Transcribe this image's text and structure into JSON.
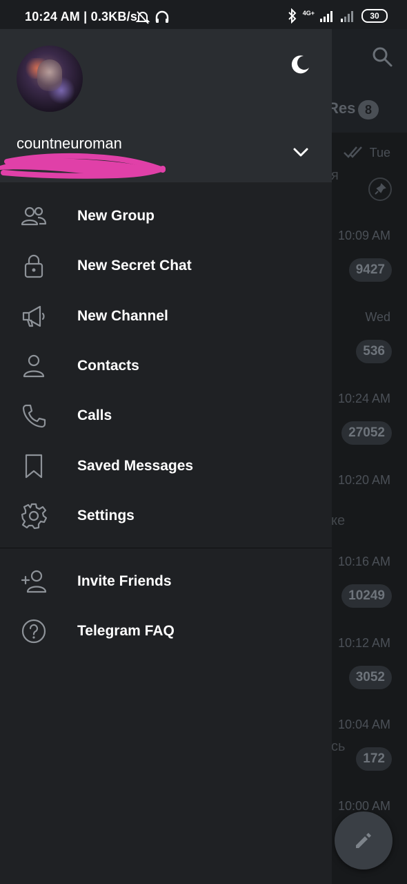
{
  "statusbar": {
    "time": "10:24 AM",
    "speed": "| 0.3KB/s",
    "network": "4G+",
    "battery": "30"
  },
  "background": {
    "tab_label": "Res",
    "tab_count": "8",
    "rows": [
      {
        "time": "Tue",
        "snippet": "я",
        "count": ""
      },
      {
        "time": "10:09 AM",
        "snippet": "",
        "count": "9427"
      },
      {
        "time": "Wed",
        "snippet": "",
        "count": "536"
      },
      {
        "time": "10:24 AM",
        "snippet": "",
        "count": "27052"
      },
      {
        "time": "10:20 AM",
        "snippet": "ке",
        "count": ""
      },
      {
        "time": "10:16 AM",
        "snippet": "",
        "count": "10249"
      },
      {
        "time": "10:12 AM",
        "snippet": "",
        "count": "3052"
      },
      {
        "time": "10:04 AM",
        "snippet": "сь",
        "count": "172"
      },
      {
        "time": "10:00 AM",
        "snippet": "",
        "count": ""
      }
    ]
  },
  "drawer": {
    "username": "countneuroman",
    "menu": [
      {
        "label": "New Group",
        "icon": "group-icon"
      },
      {
        "label": "New Secret Chat",
        "icon": "lock-icon"
      },
      {
        "label": "New Channel",
        "icon": "megaphone-icon"
      },
      {
        "label": "Contacts",
        "icon": "person-icon"
      },
      {
        "label": "Calls",
        "icon": "phone-icon"
      },
      {
        "label": "Saved Messages",
        "icon": "bookmark-icon"
      },
      {
        "label": "Settings",
        "icon": "gear-icon"
      }
    ],
    "menu2": [
      {
        "label": "Invite Friends",
        "icon": "add-person-icon"
      },
      {
        "label": "Telegram FAQ",
        "icon": "question-icon"
      }
    ]
  },
  "colors": {
    "drawer_bg": "#1f2124",
    "header_bg": "#2a2d31",
    "text": "#ffffff",
    "icon": "#8e9399",
    "scribble": "#e040a8"
  }
}
